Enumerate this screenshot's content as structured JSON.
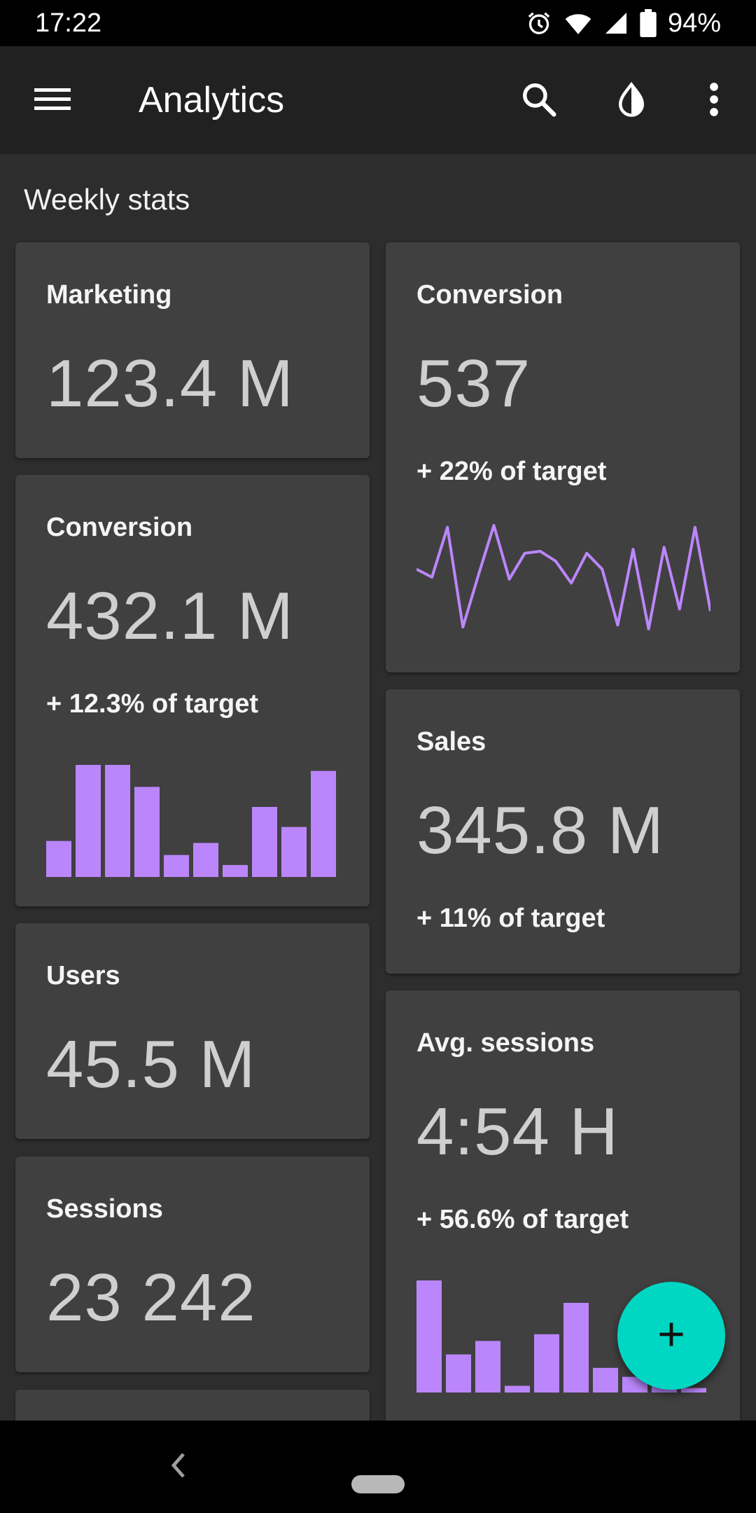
{
  "status_bar": {
    "time": "17:22",
    "battery": "94%",
    "icons": [
      "alarm-icon",
      "wifi-icon",
      "signal-icon",
      "battery-icon"
    ]
  },
  "app_bar": {
    "title": "Analytics",
    "icons": [
      "menu-icon",
      "search-icon",
      "theme-icon",
      "more-vert-icon"
    ]
  },
  "section_title": "Weekly stats",
  "colors": {
    "accent": "#bb86fc",
    "fab": "#00d7c2",
    "card": "#404040",
    "background": "#2d2d2d",
    "app_bar": "#212121"
  },
  "cards": {
    "marketing": {
      "title": "Marketing",
      "value": "123.4 M"
    },
    "conversion_left": {
      "title": "Conversion",
      "value": "432.1 M",
      "delta": "+ 12.3% of target"
    },
    "users": {
      "title": "Users",
      "value": "45.5 M"
    },
    "sessions": {
      "title": "Sessions",
      "value": "23 242"
    },
    "conversion_right": {
      "title": "Conversion",
      "value": "537",
      "delta": "+ 22% of target"
    },
    "sales": {
      "title": "Sales",
      "value": "345.8 M",
      "delta": "+ 11% of target"
    },
    "avg_sessions": {
      "title": "Avg. sessions",
      "value": "4:54 H",
      "delta": "+ 56.6% of target"
    }
  },
  "chart_data": [
    {
      "type": "bar",
      "card": "conversion_left",
      "values": [
        18,
        56,
        56,
        45,
        11,
        17,
        6,
        35,
        25,
        53
      ],
      "ylim": [
        0,
        56
      ]
    },
    {
      "type": "line",
      "card": "conversion_right",
      "values": [
        12,
        8,
        33,
        -17,
        9,
        34,
        7,
        20,
        21,
        16,
        5,
        20,
        12,
        -16,
        22,
        -18,
        23,
        -8,
        33,
        -9
      ],
      "ylim": [
        -18,
        34
      ]
    },
    {
      "type": "bar",
      "card": "avg_sessions",
      "values": [
        50,
        17,
        23,
        3,
        26,
        40,
        11,
        7,
        3,
        2
      ],
      "ylim": [
        0,
        50
      ]
    }
  ],
  "fab": {
    "icon": "add-icon"
  },
  "nav_bar": {
    "icons": [
      "back-icon",
      "home-pill"
    ]
  }
}
